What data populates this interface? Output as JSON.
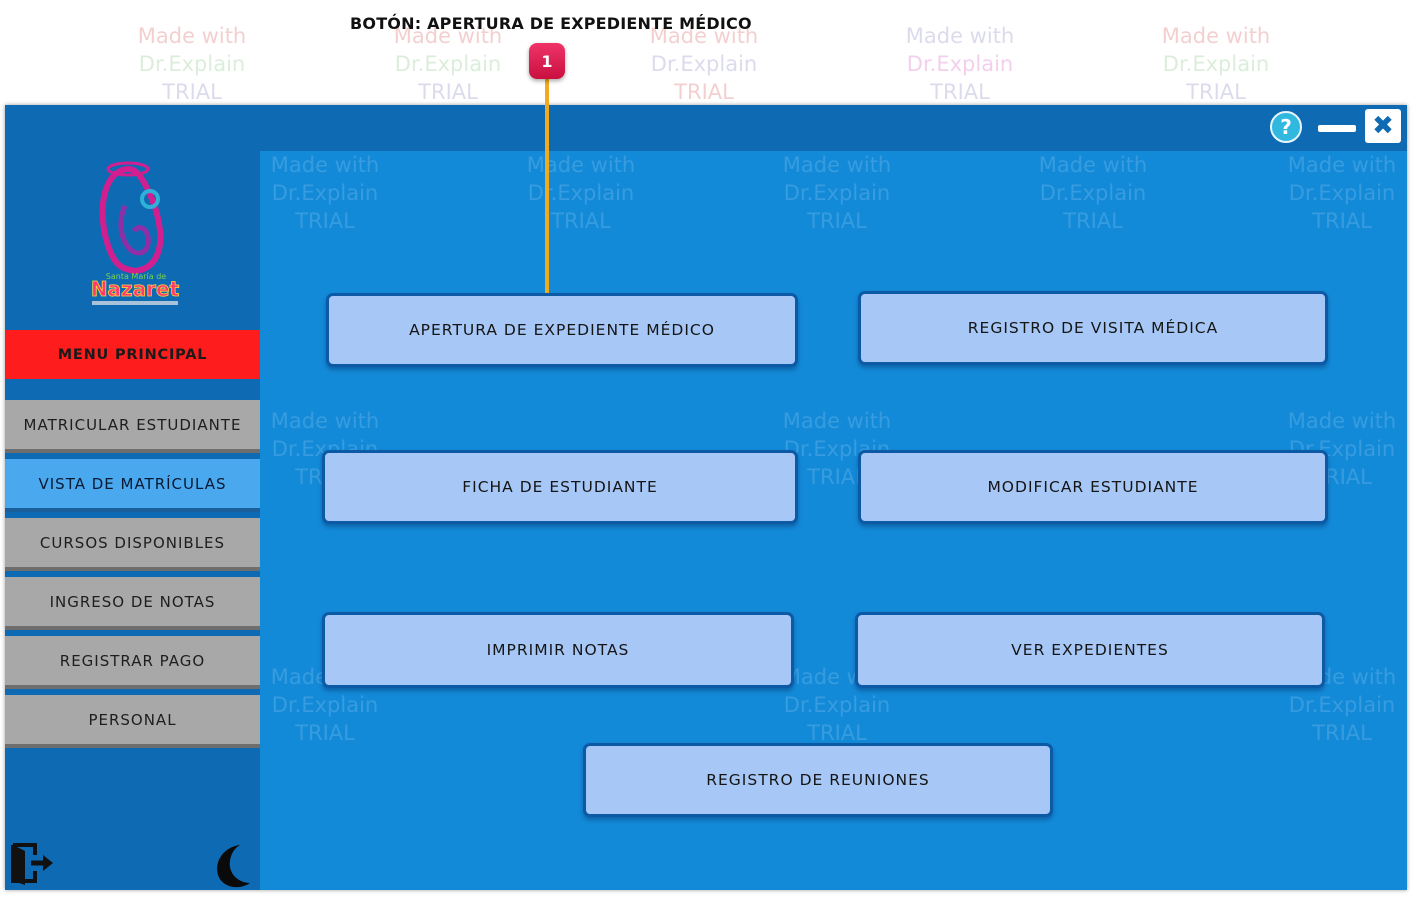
{
  "annotation": {
    "title": "BOTÓN: APERTURA DE EXPEDIENTE MÉDICO",
    "badge": "1"
  },
  "window": {
    "help_label": "?",
    "close_glyph": "✖",
    "minimize_icon": "minimize-icon",
    "logo": {
      "line1": "Santa María de",
      "line2": "Nazaret"
    }
  },
  "sidebar": {
    "header": "MENU PRINCIPAL",
    "items": [
      {
        "label": "MATRICULAR ESTUDIANTE",
        "active": false
      },
      {
        "label": "VISTA DE MATRÍCULAS",
        "active": true
      },
      {
        "label": "CURSOS DISPONIBLES",
        "active": false
      },
      {
        "label": "INGRESO DE NOTAS",
        "active": false
      },
      {
        "label": "REGISTRAR PAGO",
        "active": false
      },
      {
        "label": "PERSONAL",
        "active": false
      }
    ],
    "exit_icon": "exit-icon",
    "theme_icon": "moon-icon"
  },
  "content": {
    "buttons": [
      {
        "label": "APERTURA DE EXPEDIENTE MÉDICO"
      },
      {
        "label": "REGISTRO DE VISITA MÉDICA"
      },
      {
        "label": "FICHA DE ESTUDIANTE"
      },
      {
        "label": "MODIFICAR ESTUDIANTE"
      },
      {
        "label": "IMPRIMIR NOTAS"
      },
      {
        "label": "VER EXPEDIENTES"
      },
      {
        "label": "REGISTRO DE REUNIONES"
      }
    ]
  },
  "watermark": {
    "line1": "Made with",
    "line2": "Dr.Explain",
    "line3": "TRIAL"
  },
  "colors": {
    "window_blue": "#0f6ab4",
    "content_blue": "#138ad8",
    "menu_red": "#ff1c1c",
    "button_fill": "#a7c8f7",
    "callout_line": "#f2a91d",
    "badge": "#e0215a"
  }
}
